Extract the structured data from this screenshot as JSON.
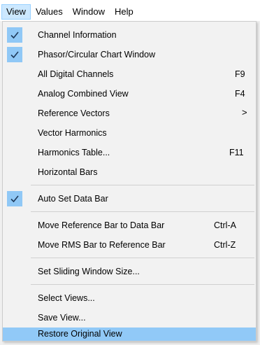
{
  "menubar": {
    "items": [
      {
        "label": "View"
      },
      {
        "label": "Values"
      },
      {
        "label": "Window"
      },
      {
        "label": "Help"
      }
    ]
  },
  "view_menu": {
    "items": [
      {
        "label": "Channel Information",
        "checked": true
      },
      {
        "label": "Phasor/Circular Chart Window",
        "checked": true
      },
      {
        "label": "All Digital Channels",
        "shortcut": "F9"
      },
      {
        "label": "Analog Combined View",
        "shortcut": "F4"
      },
      {
        "label": "Reference Vectors",
        "submenu_arrow": ">"
      },
      {
        "label": "Vector Harmonics"
      },
      {
        "label": "Harmonics Table...",
        "shortcut": "F11"
      },
      {
        "label": "Horizontal Bars"
      },
      {
        "label": "Auto Set Data Bar",
        "checked": true
      },
      {
        "label": "Move Reference Bar to Data Bar",
        "shortcut": "Ctrl-A"
      },
      {
        "label": "Move RMS Bar to Reference Bar",
        "shortcut": "Ctrl-Z"
      },
      {
        "label": "Set Sliding Window Size..."
      },
      {
        "label": "Select Views..."
      },
      {
        "label": "Save View..."
      },
      {
        "label": "Restore Original View",
        "highlighted": true
      }
    ]
  },
  "colors": {
    "check_background": "#90c8f6",
    "highlight": "#91c9f7",
    "menubar_active": "#cce8ff"
  },
  "icons": {
    "check": "checkmark-icon",
    "submenu": "chevron-right-icon"
  }
}
